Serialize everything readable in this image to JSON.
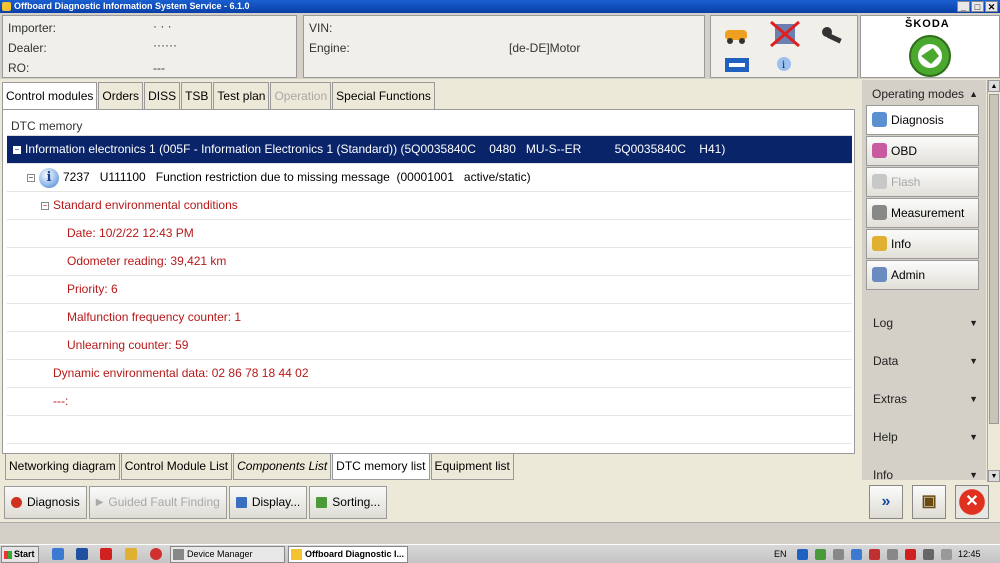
{
  "window": {
    "title": "Offboard Diagnostic Information System Service - 6.1.0",
    "controls": [
      "_",
      "□",
      "✕"
    ]
  },
  "vehicle": {
    "importer_label": "Importer:",
    "importer_value": "· · ·",
    "dealer_label": "Dealer:",
    "dealer_value": "······",
    "ro_label": "RO:",
    "ro_value": "---",
    "vin_label": "VIN:",
    "vin_value": "",
    "engine_label": "Engine:",
    "engine_value": "[de-DE]Motor"
  },
  "brand": {
    "name": "ŠKODA"
  },
  "tabs": [
    {
      "label": "Control modules",
      "state": "active"
    },
    {
      "label": "Orders",
      "state": "normal"
    },
    {
      "label": "DISS",
      "state": "normal"
    },
    {
      "label": "TSB",
      "state": "normal"
    },
    {
      "label": "Test plan",
      "state": "normal"
    },
    {
      "label": "Operation",
      "state": "disabled"
    },
    {
      "label": "Special Functions",
      "state": "normal"
    }
  ],
  "dtc": {
    "header": "DTC memory",
    "ecu_row": "Information electronics 1 (005F - Information Electronics 1 (Standard)) (5Q0035840C    0480   MU-S--ER          5Q0035840C    H41)",
    "fault_row": "7237   U111100   Function restriction due to missing message  (00001001   active/static)",
    "env_header": "Standard environmental conditions",
    "date": "Date: 10/2/22 12:43 PM",
    "odometer": "Odometer reading: 39,421 km",
    "priority": "Priority: 6",
    "malfunction": "Malfunction frequency counter: 1",
    "unlearning": "Unlearning counter: 59",
    "dynamic": "Dynamic environmental data: 02 86 78 18 44 02",
    "dashes": "---:"
  },
  "bottom_tabs": [
    {
      "label": "Networking diagram",
      "state": "normal"
    },
    {
      "label": "Control Module List",
      "state": "normal"
    },
    {
      "label": "Components List",
      "state": "italic"
    },
    {
      "label": "DTC memory list",
      "state": "active"
    },
    {
      "label": "Equipment list",
      "state": "normal"
    }
  ],
  "actions": {
    "diagnosis": "Diagnosis",
    "guided": "Guided Fault Finding",
    "display": "Display...",
    "sorting": "Sorting..."
  },
  "right_panel": {
    "operating_modes": "Operating modes",
    "diagnosis": "Diagnosis",
    "obd": "OBD",
    "flash": "Flash",
    "measurement": "Measurement",
    "info": "Info",
    "admin": "Admin",
    "log": "Log",
    "data": "Data",
    "extras": "Extras",
    "help": "Help",
    "info2": "Info",
    "expand_glyph": "»",
    "collapse_glyph": "«",
    "collapse_arrow": "«",
    "expand_arrow": "»"
  },
  "nav_buttons": {
    "forward": "»",
    "target": "▣",
    "close": "✕"
  },
  "taskbar": {
    "start": "Start",
    "task1": "Device Manager",
    "task2": "Offboard Diagnostic I...",
    "lang": "EN",
    "time": "12:45"
  },
  "colors": {
    "selection": "#0a246a",
    "env_text": "#b81818",
    "accent_green": "#4ba82e"
  }
}
